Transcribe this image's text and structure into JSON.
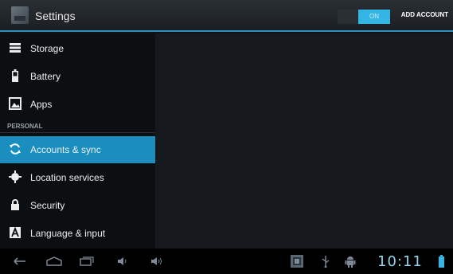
{
  "actionbar": {
    "title": "Settings",
    "toggle_label": "ON",
    "add_account_label": "ADD ACCOUNT"
  },
  "sidebar": {
    "items": [
      {
        "label": "Storage",
        "icon": "storage-icon"
      },
      {
        "label": "Battery",
        "icon": "battery-icon"
      },
      {
        "label": "Apps",
        "icon": "apps-icon"
      }
    ],
    "section_header": "PERSONAL",
    "personal_items": [
      {
        "label": "Accounts & sync",
        "icon": "sync-icon",
        "selected": true
      },
      {
        "label": "Location services",
        "icon": "location-icon"
      },
      {
        "label": "Security",
        "icon": "lock-icon"
      },
      {
        "label": "Language & input",
        "icon": "language-icon"
      }
    ]
  },
  "statusbar": {
    "time": "10:11"
  },
  "colors": {
    "accent": "#33b5e5",
    "selected_item": "#1a8fbf"
  }
}
